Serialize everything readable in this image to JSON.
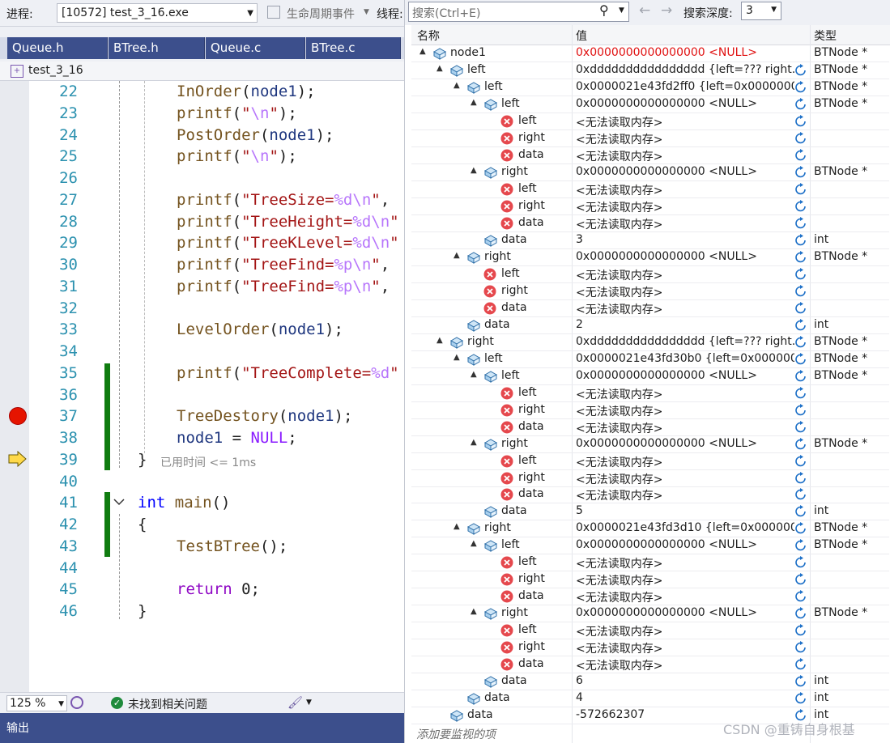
{
  "toolbar": {
    "process_label": "进程:",
    "process_value": "[10572] test_3_16.exe",
    "lifecycle_label": "生命周期事件",
    "thread_label": "线程:"
  },
  "tabs": [
    {
      "label": "Queue.h"
    },
    {
      "label": "BTree.h"
    },
    {
      "label": "Queue.c"
    },
    {
      "label": "BTree.c"
    }
  ],
  "filebar": {
    "title": "test_3_16"
  },
  "editor": {
    "lines": [
      {
        "n": "22",
        "text": "InOrder(node1);"
      },
      {
        "n": "23",
        "text": "printf(\"\\n\");"
      },
      {
        "n": "24",
        "text": "PostOrder(node1);"
      },
      {
        "n": "25",
        "text": "printf(\"\\n\");"
      },
      {
        "n": "26",
        "text": ""
      },
      {
        "n": "27",
        "text": "printf(\"TreeSize=%d\\n\","
      },
      {
        "n": "28",
        "text": "printf(\"TreeHeight=%d\\n\""
      },
      {
        "n": "29",
        "text": "printf(\"TreeKLevel=%d\\n\""
      },
      {
        "n": "30",
        "text": "printf(\"TreeFind=%p\\n\","
      },
      {
        "n": "31",
        "text": "printf(\"TreeFind=%p\\n\","
      },
      {
        "n": "32",
        "text": ""
      },
      {
        "n": "33",
        "text": "LevelOrder(node1);"
      },
      {
        "n": "34",
        "text": ""
      },
      {
        "n": "35",
        "text": "printf(\"TreeComplete=%d\""
      },
      {
        "n": "36",
        "text": ""
      },
      {
        "n": "37",
        "text": "TreeDestory(node1);"
      },
      {
        "n": "38",
        "text": "node1 = NULL;"
      },
      {
        "n": "39",
        "text": "}"
      },
      {
        "n": "40",
        "text": ""
      },
      {
        "n": "41",
        "text": "int main()"
      },
      {
        "n": "42",
        "text": "{"
      },
      {
        "n": "43",
        "text": "TestBTree();"
      },
      {
        "n": "44",
        "text": ""
      },
      {
        "n": "45",
        "text": "return 0;"
      },
      {
        "n": "46",
        "text": "}"
      }
    ],
    "elapsed_hint": "已用时间 <= 1ms"
  },
  "status": {
    "zoom": "125 %",
    "issues": "未找到相关问题"
  },
  "output": {
    "label": "输出"
  },
  "watch": {
    "search_placeholder": "搜索(Ctrl+E)",
    "depth_label": "搜索深度:",
    "depth_value": "3",
    "col_name": "名称",
    "col_value": "值",
    "col_type": "类型",
    "add_hint": "添加要监视的项",
    "rows": [
      {
        "depth": 0,
        "expand": "▲",
        "icon": "struct",
        "name": "node1",
        "value": "0x0000000000000000 <NULL>",
        "red": true,
        "refresh": false,
        "type": "BTNode *"
      },
      {
        "depth": 1,
        "expand": "▲",
        "icon": "struct",
        "name": "left",
        "value": "0xdddddddddddddddd {left=??? right...",
        "refresh": true,
        "type": "BTNode *"
      },
      {
        "depth": 2,
        "expand": "▲",
        "icon": "struct",
        "name": "left",
        "value": "0x0000021e43fd2ff0 {left=0x00000000...",
        "refresh": true,
        "type": "BTNode *"
      },
      {
        "depth": 3,
        "expand": "▲",
        "icon": "struct",
        "name": "left",
        "value": "0x0000000000000000 <NULL>",
        "refresh": true,
        "type": "BTNode *"
      },
      {
        "depth": 4,
        "expand": "",
        "icon": "error",
        "name": "left",
        "value": "<无法读取内存>",
        "refresh": true,
        "type": ""
      },
      {
        "depth": 4,
        "expand": "",
        "icon": "error",
        "name": "right",
        "value": "<无法读取内存>",
        "refresh": true,
        "type": ""
      },
      {
        "depth": 4,
        "expand": "",
        "icon": "error",
        "name": "data",
        "value": "<无法读取内存>",
        "refresh": true,
        "type": ""
      },
      {
        "depth": 3,
        "expand": "▲",
        "icon": "struct",
        "name": "right",
        "value": "0x0000000000000000 <NULL>",
        "refresh": true,
        "type": "BTNode *"
      },
      {
        "depth": 4,
        "expand": "",
        "icon": "error",
        "name": "left",
        "value": "<无法读取内存>",
        "refresh": true,
        "type": ""
      },
      {
        "depth": 4,
        "expand": "",
        "icon": "error",
        "name": "right",
        "value": "<无法读取内存>",
        "refresh": true,
        "type": ""
      },
      {
        "depth": 4,
        "expand": "",
        "icon": "error",
        "name": "data",
        "value": "<无法读取内存>",
        "refresh": true,
        "type": ""
      },
      {
        "depth": 3,
        "expand": "",
        "icon": "field",
        "name": "data",
        "value": "3",
        "refresh": true,
        "type": "int"
      },
      {
        "depth": 2,
        "expand": "▲",
        "icon": "struct",
        "name": "right",
        "value": "0x0000000000000000 <NULL>",
        "refresh": true,
        "type": "BTNode *"
      },
      {
        "depth": 3,
        "expand": "",
        "icon": "error",
        "name": "left",
        "value": "<无法读取内存>",
        "refresh": true,
        "type": ""
      },
      {
        "depth": 3,
        "expand": "",
        "icon": "error",
        "name": "right",
        "value": "<无法读取内存>",
        "refresh": true,
        "type": ""
      },
      {
        "depth": 3,
        "expand": "",
        "icon": "error",
        "name": "data",
        "value": "<无法读取内存>",
        "refresh": true,
        "type": ""
      },
      {
        "depth": 2,
        "expand": "",
        "icon": "field",
        "name": "data",
        "value": "2",
        "refresh": true,
        "type": "int"
      },
      {
        "depth": 1,
        "expand": "▲",
        "icon": "struct",
        "name": "right",
        "value": "0xdddddddddddddddd {left=??? right...",
        "refresh": true,
        "type": "BTNode *"
      },
      {
        "depth": 2,
        "expand": "▲",
        "icon": "struct",
        "name": "left",
        "value": "0x0000021e43fd30b0 {left=0x0000000...",
        "refresh": true,
        "type": "BTNode *"
      },
      {
        "depth": 3,
        "expand": "▲",
        "icon": "struct",
        "name": "left",
        "value": "0x0000000000000000 <NULL>",
        "refresh": true,
        "type": "BTNode *"
      },
      {
        "depth": 4,
        "expand": "",
        "icon": "error",
        "name": "left",
        "value": "<无法读取内存>",
        "refresh": true,
        "type": ""
      },
      {
        "depth": 4,
        "expand": "",
        "icon": "error",
        "name": "right",
        "value": "<无法读取内存>",
        "refresh": true,
        "type": ""
      },
      {
        "depth": 4,
        "expand": "",
        "icon": "error",
        "name": "data",
        "value": "<无法读取内存>",
        "refresh": true,
        "type": ""
      },
      {
        "depth": 3,
        "expand": "▲",
        "icon": "struct",
        "name": "right",
        "value": "0x0000000000000000 <NULL>",
        "refresh": true,
        "type": "BTNode *"
      },
      {
        "depth": 4,
        "expand": "",
        "icon": "error",
        "name": "left",
        "value": "<无法读取内存>",
        "refresh": true,
        "type": ""
      },
      {
        "depth": 4,
        "expand": "",
        "icon": "error",
        "name": "right",
        "value": "<无法读取内存>",
        "refresh": true,
        "type": ""
      },
      {
        "depth": 4,
        "expand": "",
        "icon": "error",
        "name": "data",
        "value": "<无法读取内存>",
        "refresh": true,
        "type": ""
      },
      {
        "depth": 3,
        "expand": "",
        "icon": "field",
        "name": "data",
        "value": "5",
        "refresh": true,
        "type": "int"
      },
      {
        "depth": 2,
        "expand": "▲",
        "icon": "struct",
        "name": "right",
        "value": "0x0000021e43fd3d10 {left=0x0000000...",
        "refresh": true,
        "type": "BTNode *"
      },
      {
        "depth": 3,
        "expand": "▲",
        "icon": "struct",
        "name": "left",
        "value": "0x0000000000000000 <NULL>",
        "refresh": true,
        "type": "BTNode *"
      },
      {
        "depth": 4,
        "expand": "",
        "icon": "error",
        "name": "left",
        "value": "<无法读取内存>",
        "refresh": true,
        "type": ""
      },
      {
        "depth": 4,
        "expand": "",
        "icon": "error",
        "name": "right",
        "value": "<无法读取内存>",
        "refresh": true,
        "type": ""
      },
      {
        "depth": 4,
        "expand": "",
        "icon": "error",
        "name": "data",
        "value": "<无法读取内存>",
        "refresh": true,
        "type": ""
      },
      {
        "depth": 3,
        "expand": "▲",
        "icon": "struct",
        "name": "right",
        "value": "0x0000000000000000 <NULL>",
        "refresh": true,
        "type": "BTNode *"
      },
      {
        "depth": 4,
        "expand": "",
        "icon": "error",
        "name": "left",
        "value": "<无法读取内存>",
        "refresh": true,
        "type": ""
      },
      {
        "depth": 4,
        "expand": "",
        "icon": "error",
        "name": "right",
        "value": "<无法读取内存>",
        "refresh": true,
        "type": ""
      },
      {
        "depth": 4,
        "expand": "",
        "icon": "error",
        "name": "data",
        "value": "<无法读取内存>",
        "refresh": true,
        "type": ""
      },
      {
        "depth": 3,
        "expand": "",
        "icon": "field",
        "name": "data",
        "value": "6",
        "refresh": true,
        "type": "int"
      },
      {
        "depth": 2,
        "expand": "",
        "icon": "field",
        "name": "data",
        "value": "4",
        "refresh": true,
        "type": "int"
      },
      {
        "depth": 1,
        "expand": "",
        "icon": "field",
        "name": "data",
        "value": "-572662307",
        "refresh": true,
        "type": "int"
      }
    ]
  },
  "watermark": "CSDN @重铸自身根基"
}
